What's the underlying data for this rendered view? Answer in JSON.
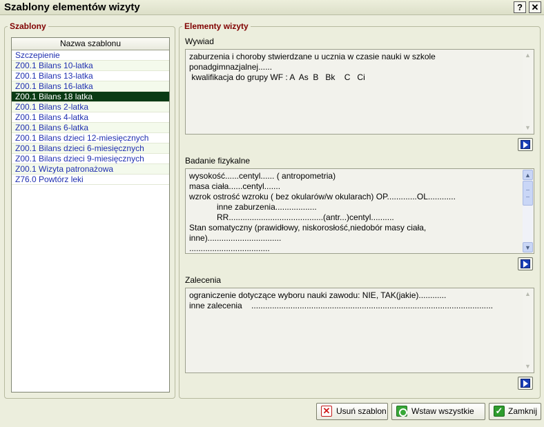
{
  "window": {
    "title": "Szablony elementów wizyty",
    "help_glyph": "?",
    "close_glyph": "✕"
  },
  "templates_panel": {
    "legend": "Szablony",
    "column_header": "Nazwa szablonu",
    "items": [
      "Szczepienie",
      "Z00.1 Bilans 10-latka",
      "Z00.1 Bilans 13-latka",
      "Z00.1 Bilans 16-latka",
      "Z00.1 Bilans 18 latka",
      "Z00.1 Bilans 2-latka",
      "Z00.1 Bilans 4-latka",
      "Z00.1 Bilans 6-latka",
      "Z00.1 Bilans dzieci 12-miesięcznych",
      "Z00.1 Bilans dzieci 6-miesięcznych",
      "Z00.1 Bilans dzieci 9-miesięcznych",
      "Z00.1 Wizyta patronażowa",
      "Z76.0 Powtórz leki"
    ],
    "selected": "Z00.1 Bilans 18 latka"
  },
  "visit_elements": {
    "legend": "Elementy wizyty",
    "interview": {
      "label": "Wywiad",
      "text": "zaburzenia i choroby stwierdzane u ucznia w czasie nauki w szkole\nponadgimnazjalnej......\n kwalifikacja do grupy WF : A  As  B   Bk    C   Ci"
    },
    "physical_exam": {
      "label": "Badanie fizykalne",
      "text": "wysokość......centyl...... ( antropometria)\nmasa ciała......centyl.......\nwzrok ostrość wzroku ( bez okularów/w okularach) OP.............OL............\n            inne zaburzenia..................\n            RR.........................................(antr...)centyl..........\nStan somatyczny (prawidłowy, niskorosłość,niedobór masy ciała,\ninne)................................\n..................................."
    },
    "recommendations": {
      "label": "Zalecenia",
      "text": "ograniczenie dotyczące wyboru nauki zawodu: NIE, TAK(jakie)............\ninne zalecenia    ........................................................................................................."
    },
    "scroll_up_glyph": "▲",
    "scroll_down_glyph": "▼"
  },
  "buttons": {
    "delete_template": "Usuń szablon",
    "delete_icon_glyph": "✕",
    "insert_all": "Wstaw wszystkie",
    "close": "Zamknij",
    "close_icon_glyph": "✓"
  },
  "icons": {
    "delete": "red-x-icon",
    "insert_all": "green-circle-icon",
    "close": "green-check-icon",
    "insert": "blue-arrow-right-icon"
  }
}
